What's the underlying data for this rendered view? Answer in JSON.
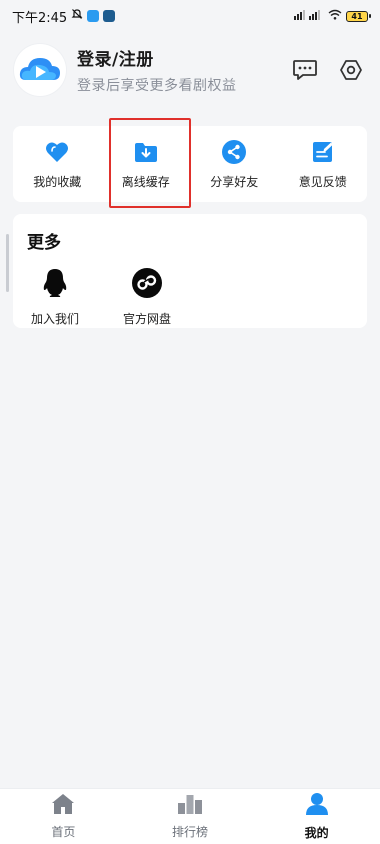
{
  "status_bar": {
    "time": "下午2:45",
    "battery": "41"
  },
  "profile": {
    "title": "登录/注册",
    "subtitle": "登录后享受更多看剧权益"
  },
  "features": [
    {
      "label": "我的收藏",
      "icon": "heart-icon"
    },
    {
      "label": "离线缓存",
      "icon": "download-folder-icon"
    },
    {
      "label": "分享好友",
      "icon": "share-icon"
    },
    {
      "label": "意见反馈",
      "icon": "feedback-icon"
    }
  ],
  "more": {
    "title": "更多",
    "items": [
      {
        "label": "加入我们",
        "icon": "qq-icon"
      },
      {
        "label": "官方网盘",
        "icon": "cloud-drive-icon"
      }
    ]
  },
  "bottom_nav": [
    {
      "label": "首页",
      "icon": "home-icon",
      "active": false
    },
    {
      "label": "排行榜",
      "icon": "ranking-icon",
      "active": false
    },
    {
      "label": "我的",
      "icon": "profile-icon",
      "active": true
    }
  ],
  "colors": {
    "accent": "#1f8ff0",
    "highlight": "#e0302b"
  }
}
